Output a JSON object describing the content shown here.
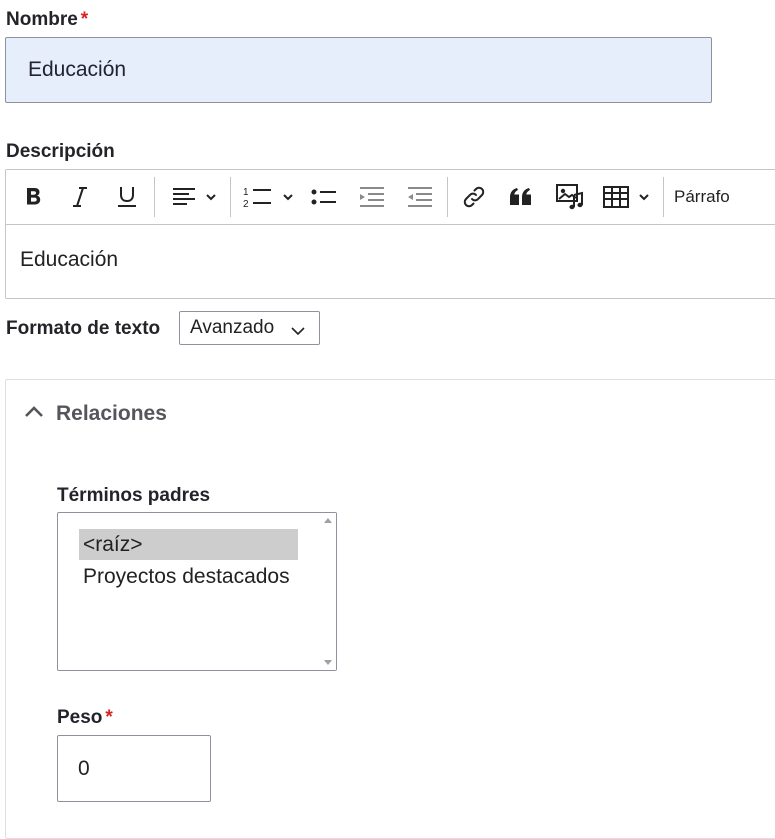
{
  "nombre": {
    "label": "Nombre",
    "required_mark": "*",
    "value": "Educación"
  },
  "descripcion": {
    "label": "Descripción",
    "toolbar": {
      "bold_icon": "bold-icon",
      "italic_icon": "italic-icon",
      "underline_icon": "underline-icon",
      "align_icon": "align-left-icon",
      "numbered_list_icon": "numbered-list-icon",
      "bulleted_list_icon": "bulleted-list-icon",
      "indent_icon": "indent-icon",
      "outdent_icon": "outdent-icon",
      "link_icon": "link-icon",
      "quote_icon": "blockquote-icon",
      "media_icon": "media-icon",
      "table_icon": "table-icon",
      "heading_label": "Párrafo"
    },
    "content": "Educación"
  },
  "formato": {
    "label": "Formato de texto",
    "selected": "Avanzado"
  },
  "relaciones": {
    "title": "Relaciones",
    "terminos_padres": {
      "label": "Términos padres",
      "options": [
        "<raíz>",
        "Proyectos destacados"
      ],
      "selected_index": 0
    },
    "peso": {
      "label": "Peso",
      "required_mark": "*",
      "value": "0"
    }
  },
  "colors": {
    "required": "#d72222",
    "focused_input_bg": "#e6eefc",
    "selected_option_bg": "#cdcdcd"
  }
}
